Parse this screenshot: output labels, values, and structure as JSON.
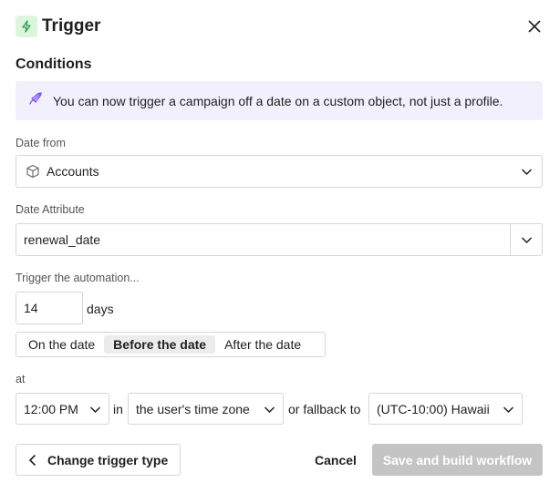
{
  "header": {
    "title": "Trigger"
  },
  "section": {
    "title": "Conditions"
  },
  "banner": {
    "text": "You can now trigger a campaign off a date on a custom object, not just a profile."
  },
  "date_from": {
    "label": "Date from",
    "value": "Accounts"
  },
  "date_attribute": {
    "label": "Date Attribute",
    "value": "renewal_date"
  },
  "trigger": {
    "label": "Trigger the automation...",
    "amount": "14",
    "unit": "days",
    "options": [
      "On the date",
      "Before the date",
      "After the date"
    ],
    "selected": "Before the date"
  },
  "at": {
    "label": "at",
    "time": "12:00 PM",
    "in_text": "in",
    "timezone": "the user's time zone",
    "fallback_text": "or fallback to",
    "fallback_zone": "(UTC-10:00) Hawaii"
  },
  "footer": {
    "back_label": "Change trigger type",
    "cancel_label": "Cancel",
    "save_label": "Save and build workflow"
  },
  "colors": {
    "accent": "#7c4dff",
    "trigger_icon": "#2e9e4a",
    "disabled": "#c4c4c4"
  }
}
